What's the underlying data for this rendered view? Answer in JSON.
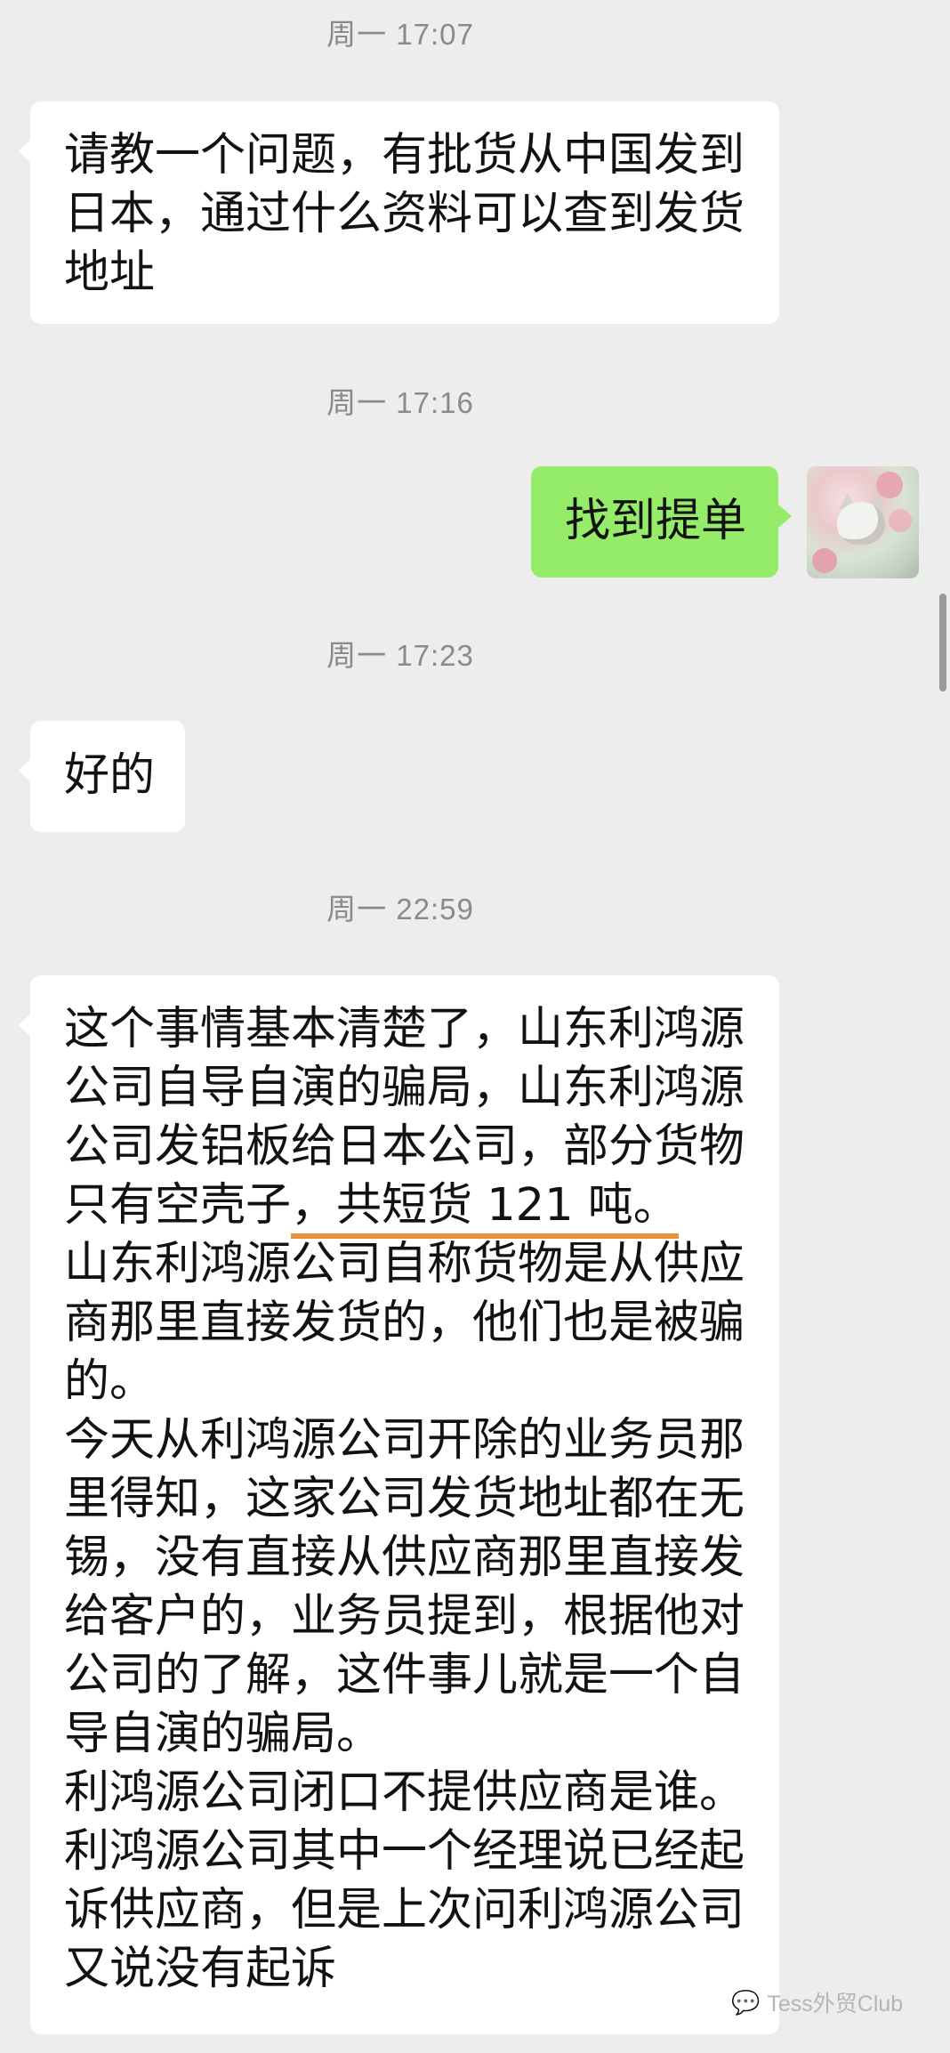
{
  "messages": [
    {
      "timestamp": "周一 17:07",
      "sender": "other",
      "lines": [
        "请教一个问题，有批货从中国发到",
        "日本，通过什么资料可以查到发货",
        "地址"
      ]
    },
    {
      "timestamp": "周一 17:16",
      "sender": "self",
      "lines": [
        "找到提单"
      ]
    },
    {
      "timestamp": "周一 17:23",
      "sender": "other",
      "lines": [
        "好的"
      ]
    },
    {
      "timestamp": "周一 22:59",
      "sender": "other",
      "lines": [
        "这个事情基本清楚了，山东利鸿源",
        "公司自导自演的骗局，山东利鸿源",
        "公司发铝板给日本公司，部分货物",
        "只有空壳子",
        "山东利鸿源公司自称货物是从供应",
        "商那里直接发货的，他们也是被骗",
        "的。",
        "今天从利鸿源公司开除的业务员那",
        "里得知，这家公司发货地址都在无",
        "锡，没有直接从供应商那里直接发",
        "给客户的，业务员提到，根据他对",
        "公司的了解，这件事儿就是一个自",
        "导自演的骗局。",
        "利鸿源公司闭口不提供应商是谁。",
        "利鸿源公司其中一个经理说已经起",
        "诉供应商，但是上次问利鸿源公司",
        "又说没有起诉"
      ],
      "underlined_text": "，共短货 121 吨。"
    }
  ],
  "watermark": {
    "icon": "wechat-icon",
    "text": "Tess外贸Club"
  },
  "colors": {
    "background": "#ededed",
    "incoming_bubble": "#ffffff",
    "outgoing_bubble": "#95ec69",
    "underline": "#e8913e",
    "timestamp_text": "#8a8a8a"
  }
}
